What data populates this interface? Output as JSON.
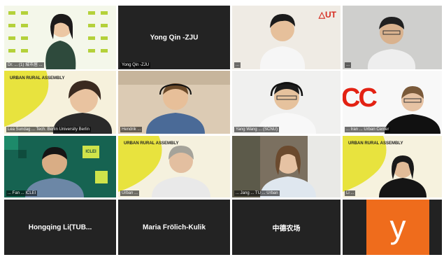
{
  "meeting": {
    "participants": [
      {
        "id": "p1",
        "name": "Dr. ... (1) 城市居 ...",
        "caption_visible": true
      },
      {
        "id": "p2",
        "name": "Yong Qin -ZJU",
        "caption_visible": true
      },
      {
        "id": "p3",
        "name": "...",
        "caption_visible": true
      },
      {
        "id": "p4",
        "name": "...",
        "caption_visible": true
      },
      {
        "id": "p5",
        "name": "Lea Sundag ... Tech. Berlin University Berlin",
        "caption_visible": true
      },
      {
        "id": "p6",
        "name": "Hendrik ...",
        "caption_visible": true
      },
      {
        "id": "p7",
        "name": "Yang Wang ... (SCNU)",
        "caption_visible": true
      },
      {
        "id": "p8",
        "name": "... Iran ... Urban Center",
        "caption_visible": true
      },
      {
        "id": "p9",
        "name": "... Fan ... ICLEI",
        "caption_visible": true
      },
      {
        "id": "p10",
        "name": "Urban ...",
        "caption_visible": true
      },
      {
        "id": "p11",
        "name": "... Jang ... TU ... Urban",
        "caption_visible": true
      },
      {
        "id": "p12",
        "name": "Li ...",
        "caption_visible": true
      },
      {
        "id": "p13",
        "name": "Hongqing Li(TUB...",
        "caption_visible": true
      },
      {
        "id": "p14",
        "name": "Maria Frölich-Kulik",
        "caption_visible": true
      },
      {
        "id": "p15",
        "name": "中德农场",
        "caption_visible": true
      },
      {
        "id": "p16",
        "name": "",
        "caption_visible": false
      }
    ]
  },
  "logos": {
    "urban_rural_assembly": "URBAN RURAL ASSEMBLY",
    "iclei": "ICLEI",
    "cc": "CC",
    "ut": "△UT"
  },
  "avatar_initial": "y",
  "colors": {
    "yellow": "#e8e33e",
    "orange": "#ef6c1c",
    "dark_tile": "#232323",
    "red_brand": "#e32213"
  }
}
